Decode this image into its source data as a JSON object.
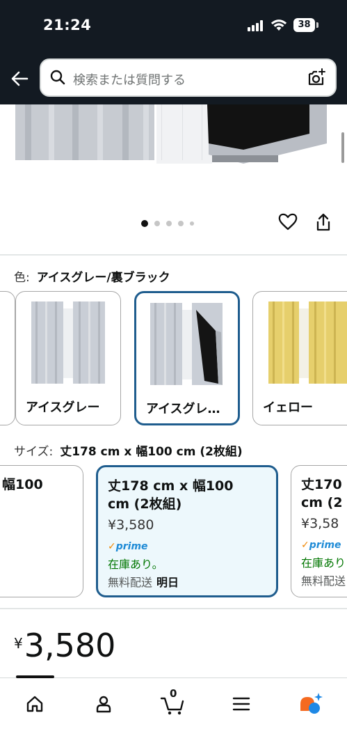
{
  "status_bar": {
    "time": "21:24",
    "battery": "38"
  },
  "search": {
    "placeholder": "検索または質問する"
  },
  "gallery": {
    "image_count": 5,
    "active_index": 0
  },
  "color": {
    "label": "色:",
    "selected": "アイスグレー/裏ブラック",
    "options": [
      {
        "label": "アイスグレー",
        "selected": false
      },
      {
        "label": "アイスグレ…",
        "selected": true
      },
      {
        "label": "イェロー",
        "selected": false
      }
    ]
  },
  "size": {
    "label": "サイズ:",
    "selected": "丈178 cm x 幅100 cm (2枚組)",
    "options": [
      {
        "title": "幅100",
        "selected": false
      },
      {
        "title_line1": "丈178 cm x 幅100",
        "title_line2": "cm (2枚組)",
        "price": "¥3,580",
        "prime": "prime",
        "stock": "在庫あり。",
        "shipping": "無料配送",
        "delivery": "明日",
        "selected": true
      },
      {
        "title_line1": "丈170",
        "title_line2": "cm (2",
        "price": "¥3,58",
        "prime": "prime",
        "stock": "在庫あり",
        "shipping": "無料配送",
        "selected": false
      }
    ]
  },
  "price": {
    "currency": "¥",
    "amount": "3,580"
  },
  "cart": {
    "count": "0"
  },
  "colors": {
    "header_bg": "#131a22",
    "selected_border": "#1f5d8e",
    "prime_blue": "#1f8bd6",
    "in_stock_green": "#007600",
    "ai_orange": "#f56a20",
    "ai_blue": "#1e88e5"
  }
}
